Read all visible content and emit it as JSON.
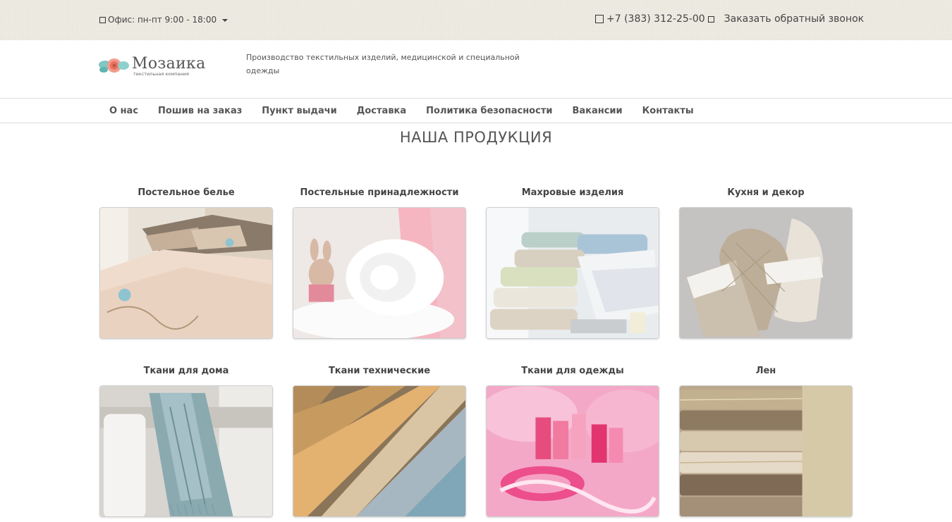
{
  "topbar": {
    "office_hours": "Офис: пн-пт 9:00 - 18:00",
    "phone": "+7 (383) 312-25-00",
    "callback": "Заказать обратный звонок"
  },
  "header": {
    "logo_name": "Мозаика",
    "logo_subtitle": "текстильная компания",
    "tagline": "Производство текстильных изделий, медицинской и специальной одежды"
  },
  "nav": {
    "items": [
      "О нас",
      "Пошив на заказ",
      "Пункт выдачи",
      "Доставка",
      "Политика безопасности",
      "Вакансии",
      "Контакты"
    ]
  },
  "products": {
    "title": "НАША ПРОДУКЦИЯ",
    "items": [
      {
        "label": "Постельное белье",
        "image": "bed-linen-photo"
      },
      {
        "label": "Постельные принадлежности",
        "image": "bedding-accessories-photo"
      },
      {
        "label": "Махровые изделия",
        "image": "terry-towels-photo"
      },
      {
        "label": "Кухня и декор",
        "image": "kitchen-mitt-photo"
      },
      {
        "label": "Ткани для дома",
        "image": "home-fabric-throw-photo"
      },
      {
        "label": "Ткани технические",
        "image": "technical-fabrics-photo"
      },
      {
        "label": "Ткани для одежды",
        "image": "clothing-fabric-threads-photo"
      },
      {
        "label": "Лен",
        "image": "linen-fabric-photo"
      }
    ]
  }
}
